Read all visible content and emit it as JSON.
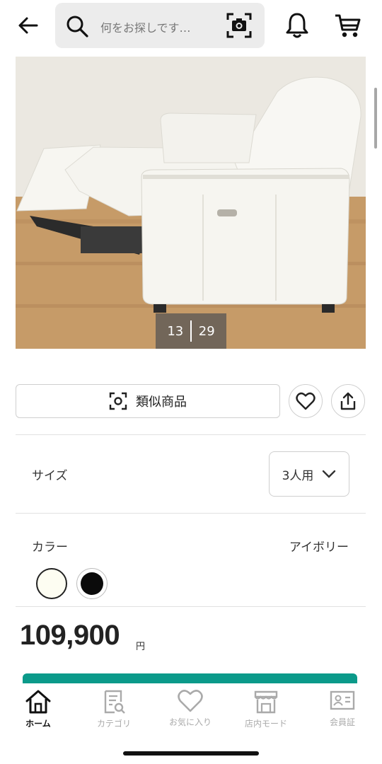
{
  "header": {
    "back_icon": "arrow-left-icon",
    "search_placeholder": "何をお探しです…",
    "search_icon": "search-icon",
    "camera_icon": "camera-scan-icon",
    "notification_icon": "bell-icon",
    "cart_icon": "cart-icon"
  },
  "gallery": {
    "current": "13",
    "total": "29"
  },
  "actions": {
    "similar_label": "類似商品",
    "favorite_icon": "heart-icon",
    "share_icon": "share-icon"
  },
  "size": {
    "label": "サイズ",
    "selected": "3人用"
  },
  "color": {
    "label": "カラー",
    "selected": "アイボリー",
    "swatches": [
      {
        "name": "ivory",
        "hex": "#fdfdf2"
      },
      {
        "name": "black",
        "hex": "#0b0b0b"
      }
    ]
  },
  "price": {
    "amount": "109,900",
    "unit": "円"
  },
  "colors": {
    "accent": "#0b9a8a",
    "search_bg": "#ececec",
    "inactive": "#aaaaaa"
  },
  "bottom_nav": {
    "items": [
      {
        "label": "ホーム",
        "icon": "home-icon",
        "active": true
      },
      {
        "label": "カテゴリ",
        "icon": "category-icon",
        "active": false
      },
      {
        "label": "お気に入り",
        "icon": "heart-icon",
        "active": false
      },
      {
        "label": "店内モード",
        "icon": "store-icon",
        "active": false
      },
      {
        "label": "会員証",
        "icon": "member-card-icon",
        "active": false
      }
    ]
  }
}
